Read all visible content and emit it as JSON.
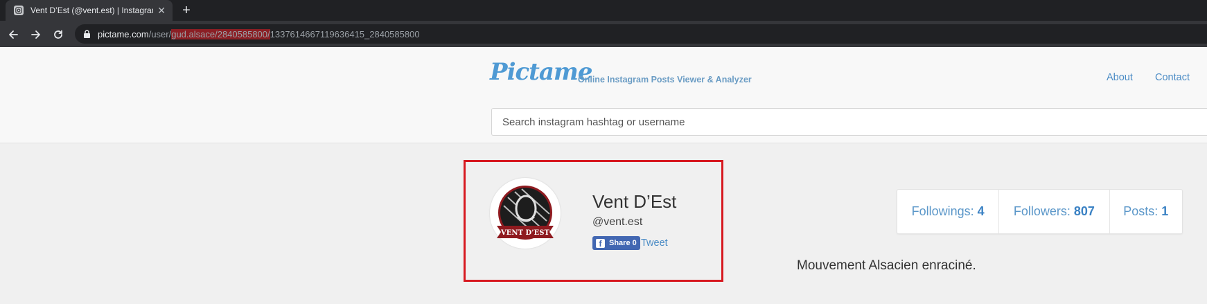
{
  "browser": {
    "tab_title": "Vent D’Est (@vent.est) | Instagram",
    "tab_close": "✕",
    "new_tab": "+",
    "url_domain": "pictame.com",
    "url_path_prefix": "/user/",
    "url_highlight": "gud.alsace/2840585800/",
    "url_path_suffix": "1337614667119636415_2840585800"
  },
  "header": {
    "logo": "Pictame",
    "tagline": "Online Instagram Posts Viewer & Analyzer",
    "nav": {
      "about": "About",
      "contact": "Contact"
    },
    "search_placeholder": "Search instagram hashtag or username"
  },
  "profile": {
    "name": "Vent D’Est",
    "handle": "@vent.est",
    "share_label": "Share 0",
    "tweet_label": "Tweet",
    "avatar_text": "VENT D’EST",
    "bio": "Mouvement Alsacien enraciné."
  },
  "stats": {
    "followings_label": "Followings:",
    "followings_value": "4",
    "followers_label": "Followers:",
    "followers_value": "807",
    "posts_label": "Posts:",
    "posts_value": "1"
  },
  "colors": {
    "browser_bg": "#202124",
    "toolbar_bg": "#35363a",
    "url_highlight": "#8b1e24",
    "link_blue": "#4a8bc5",
    "annotation_red": "#d71920",
    "facebook_blue": "#4267b2"
  },
  "icons": [
    "instagram-favicon",
    "close-icon",
    "plus-icon",
    "back-arrow-icon",
    "forward-arrow-icon",
    "reload-icon",
    "lock-icon",
    "facebook-icon"
  ]
}
